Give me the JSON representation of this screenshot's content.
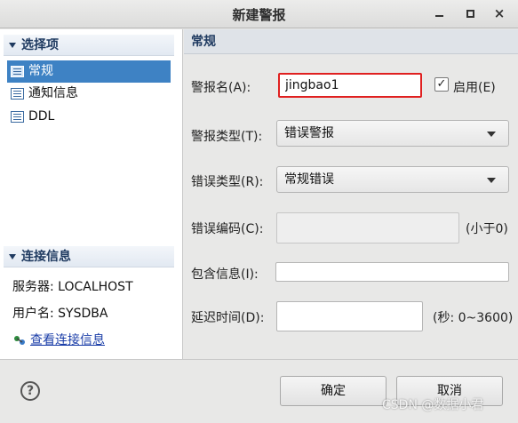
{
  "window": {
    "title": "新建警报",
    "min_icon": "minimize-icon",
    "max_icon": "maximize-icon",
    "close_glyph": "×"
  },
  "sidebar": {
    "section_title": "选择项",
    "items": [
      {
        "label": "常规",
        "active": true
      },
      {
        "label": "通知信息",
        "active": false
      },
      {
        "label": "DDL",
        "active": false
      }
    ],
    "connection": {
      "section_title": "连接信息",
      "server": "服务器: LOCALHOST",
      "user": "用户名: SYSDBA",
      "link": "查看连接信息"
    }
  },
  "main": {
    "section_title": "常规",
    "alarm_name": {
      "label": "警报名(A):",
      "value": "jingbao1"
    },
    "enable": {
      "label": "启用(E)",
      "checked": true,
      "check_glyph": "✓"
    },
    "alarm_type": {
      "label": "警报类型(T):",
      "value": "错误警报"
    },
    "error_type": {
      "label": "错误类型(R):",
      "value": "常规错误"
    },
    "error_code": {
      "label": "错误编码(C):",
      "value": "",
      "hint": "(小于0)"
    },
    "contains_info": {
      "label": "包含信息(I):",
      "value": ""
    },
    "delay": {
      "label": "延迟时间(D):",
      "value": "",
      "hint": "(秒: 0~3600)"
    }
  },
  "footer": {
    "help_glyph": "?",
    "ok_label": "确定",
    "cancel_label": "取消",
    "watermark": "CSDN @数据小君"
  },
  "colors": {
    "selection": "#3e82c4",
    "focus_border": "#e02020",
    "section_text": "#1f3a60",
    "link": "#1b3ea8"
  }
}
